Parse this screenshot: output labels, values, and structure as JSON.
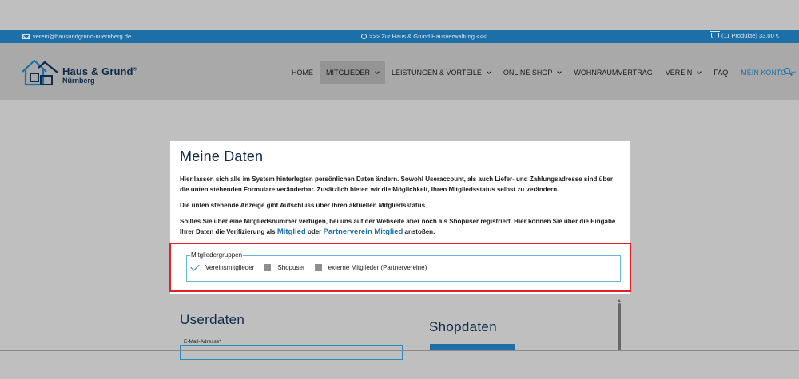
{
  "topbar": {
    "email": "verein@hausundgrund-nuernberg.de",
    "center_link": ">>> Zur Haus & Grund Hausverwaltung <<<",
    "cart": "(11 Produkte) 33,00 €"
  },
  "logo": {
    "brand": "Haus & Grund",
    "registered": "®",
    "city": "Nürnberg"
  },
  "nav": {
    "items": [
      {
        "label": "HOME"
      },
      {
        "label": "MITGLIEDER"
      },
      {
        "label": "LEISTUNGEN & VORTEILE"
      },
      {
        "label": "ONLINE SHOP"
      },
      {
        "label": "WOHNRAUMVERTRAG"
      },
      {
        "label": "VEREIN"
      },
      {
        "label": "FAQ"
      },
      {
        "label": "MEIN KONTO"
      }
    ]
  },
  "card": {
    "title": "Meine Daten",
    "para1": "Hier lassen sich alle im System hinterlegten persönlichen Daten ändern. Sowohl Useraccount, als auch Liefer- und Zahlungsadresse sind über die unten stehenden Formulare veränderbar. Zusätzlich bieten wir die Möglichkeit, Ihren Mitgliedsstatus selbst zu verändern.",
    "para2": "Die unten stehende Anzeige gibt Aufschluss über Ihren aktuellen Mitgliedsstatus",
    "para3_start": "Solltes Sie über eine Mitgliedsnummer verfügen, bei uns auf der Webseite aber noch als Shopuser registriert. Hier können Sie über die Eingabe Ihrer Daten die Verifizierung als ",
    "link_mitglied": "Mitglied",
    "para3_mid": " oder ",
    "link_partner": "Partnerverein Mitglied",
    "para3_end": " anstoßen.",
    "groups_legend": "Mitgliedergruppen",
    "group_1": "Vereinsmitglieder",
    "group_2": "Shopuser",
    "group_3": "externe Mitglieder (Partnervereine)"
  },
  "lower": {
    "userdaten": "Userdaten",
    "shopdaten": "Shopdaten",
    "email_label": "E-Mail-Adresse*"
  },
  "colors": {
    "accent": "#1d6fa8",
    "highlight": "#e0202a",
    "navy": "#0d2a4a"
  }
}
